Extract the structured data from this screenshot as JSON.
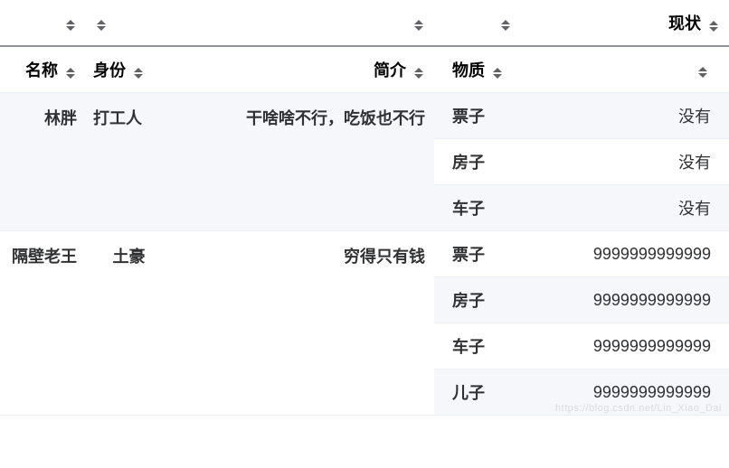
{
  "columns": {
    "name": "名称",
    "identity": "身份",
    "intro": "简介",
    "material": "物质",
    "status_top": "现状",
    "status_sub": ""
  },
  "rows": [
    {
      "name": "林胖",
      "identity": "打工人",
      "intro": "干啥啥不行，吃饭也不行",
      "details": [
        {
          "material": "票子",
          "status": "没有"
        },
        {
          "material": "房子",
          "status": "没有"
        },
        {
          "material": "车子",
          "status": "没有"
        }
      ]
    },
    {
      "name": "隔壁老王",
      "identity": "土豪",
      "intro": "穷得只有钱",
      "details": [
        {
          "material": "票子",
          "status": "9999999999999"
        },
        {
          "material": "房子",
          "status": "9999999999999"
        },
        {
          "material": "车子",
          "status": "9999999999999"
        },
        {
          "material": "儿子",
          "status": "9999999999999"
        }
      ]
    }
  ],
  "watermark": "https://blog.csdn.net/Lin_Xiao_Dai"
}
